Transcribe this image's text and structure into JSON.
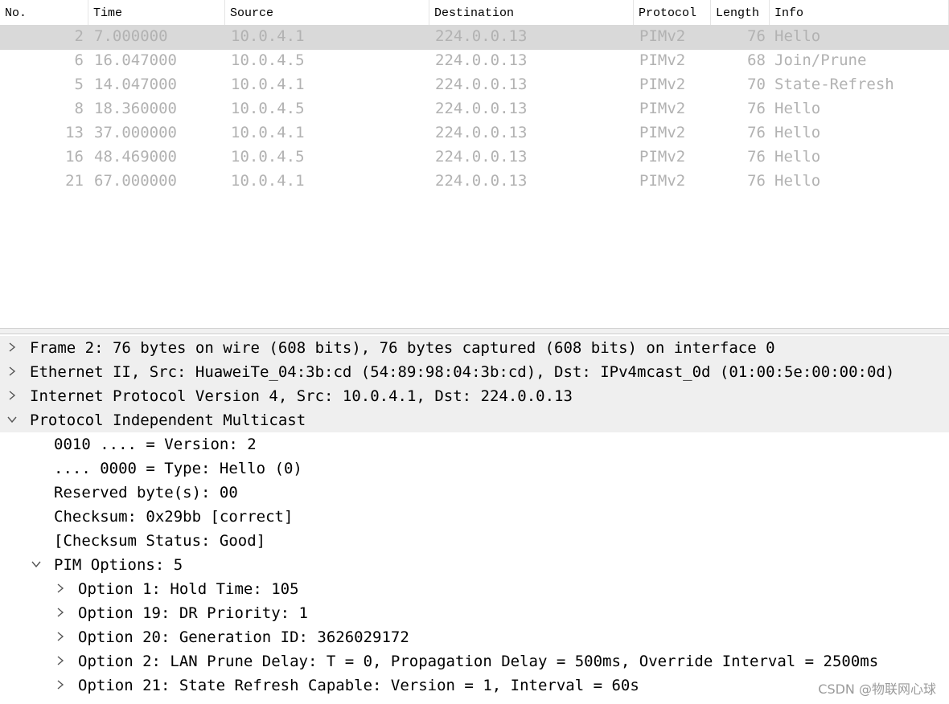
{
  "packet_list": {
    "columns": [
      "No.",
      "Time",
      "Source",
      "Destination",
      "Protocol",
      "Length",
      "Info"
    ],
    "rows": [
      {
        "no": "2",
        "time": "7.000000",
        "source": "10.0.4.1",
        "destination": "224.0.0.13",
        "protocol": "PIMv2",
        "length": "76",
        "info": "Hello",
        "selected": true
      },
      {
        "no": "6",
        "time": "16.047000",
        "source": "10.0.4.5",
        "destination": "224.0.0.13",
        "protocol": "PIMv2",
        "length": "68",
        "info": "Join/Prune"
      },
      {
        "no": "5",
        "time": "14.047000",
        "source": "10.0.4.1",
        "destination": "224.0.0.13",
        "protocol": "PIMv2",
        "length": "70",
        "info": "State-Refresh"
      },
      {
        "no": "8",
        "time": "18.360000",
        "source": "10.0.4.5",
        "destination": "224.0.0.13",
        "protocol": "PIMv2",
        "length": "76",
        "info": "Hello"
      },
      {
        "no": "13",
        "time": "37.000000",
        "source": "10.0.4.1",
        "destination": "224.0.0.13",
        "protocol": "PIMv2",
        "length": "76",
        "info": "Hello"
      },
      {
        "no": "16",
        "time": "48.469000",
        "source": "10.0.4.5",
        "destination": "224.0.0.13",
        "protocol": "PIMv2",
        "length": "76",
        "info": "Hello"
      },
      {
        "no": "21",
        "time": "67.000000",
        "source": "10.0.4.1",
        "destination": "224.0.0.13",
        "protocol": "PIMv2",
        "length": "76",
        "info": "Hello"
      }
    ]
  },
  "details": {
    "rows": [
      {
        "text": "Frame 2: 76 bytes on wire (608 bits), 76 bytes captured (608 bits) on interface 0",
        "level": 0,
        "expander": "collapsed",
        "shaded": true
      },
      {
        "text": "Ethernet II, Src: HuaweiTe_04:3b:cd (54:89:98:04:3b:cd), Dst: IPv4mcast_0d (01:00:5e:00:00:0d)",
        "level": 0,
        "expander": "collapsed",
        "shaded": true
      },
      {
        "text": "Internet Protocol Version 4, Src: 10.0.4.1, Dst: 224.0.0.13",
        "level": 0,
        "expander": "collapsed",
        "shaded": true
      },
      {
        "text": "Protocol Independent Multicast",
        "level": 0,
        "expander": "expanded",
        "shaded": true
      },
      {
        "text": "0010 .... = Version: 2",
        "level": 1,
        "expander": "none"
      },
      {
        "text": ".... 0000 = Type: Hello (0)",
        "level": 1,
        "expander": "none"
      },
      {
        "text": "Reserved byte(s): 00",
        "level": 1,
        "expander": "none"
      },
      {
        "text": "Checksum: 0x29bb [correct]",
        "level": 1,
        "expander": "none"
      },
      {
        "text": "[Checksum Status: Good]",
        "level": 1,
        "expander": "none"
      },
      {
        "text": "PIM Options: 5",
        "level": 1,
        "expander": "expanded"
      },
      {
        "text": "Option 1: Hold Time: 105",
        "level": 2,
        "expander": "collapsed"
      },
      {
        "text": "Option 19: DR Priority: 1",
        "level": 2,
        "expander": "collapsed"
      },
      {
        "text": "Option 20: Generation ID: 3626029172",
        "level": 2,
        "expander": "collapsed"
      },
      {
        "text": "Option 2: LAN Prune Delay: T = 0, Propagation Delay = 500ms, Override Interval = 2500ms",
        "level": 2,
        "expander": "collapsed"
      },
      {
        "text": "Option 21: State Refresh Capable: Version = 1, Interval = 60s",
        "level": 2,
        "expander": "collapsed"
      }
    ]
  },
  "watermark": "CSDN @物联网心球",
  "colors": {
    "selected_row": "#d9d9d9",
    "dim_text": "#b2b2b2",
    "shaded_row": "#efefef"
  },
  "icons": {
    "collapsed": "chevron-right-icon",
    "expanded": "chevron-down-icon"
  }
}
